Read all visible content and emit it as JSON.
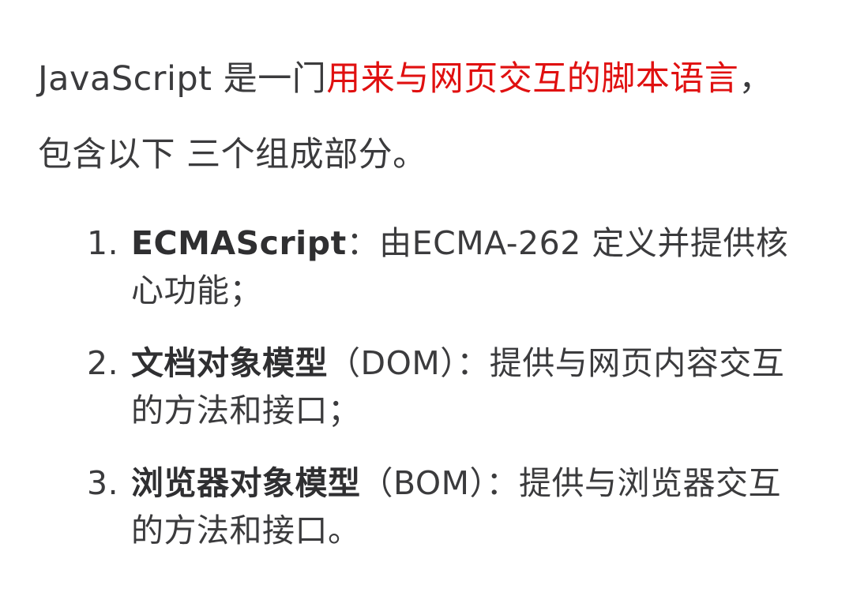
{
  "intro": {
    "prefix": "JavaScript 是一门",
    "highlight": "用来与网页交互的脚本语言",
    "suffix": "，包含以下 三个组成部分。",
    "highlight_color": "#e01010"
  },
  "items": [
    {
      "number": "1.",
      "term": "ECMAScript",
      "description": "：由ECMA-262 定义并提供核心功能；"
    },
    {
      "number": "2.",
      "term": "文档对象模型",
      "description": "（DOM）：提供与网页内容交互的方法和接口；"
    },
    {
      "number": "3.",
      "term": "浏览器对象模型",
      "description": "（BOM）：提供与浏览器交互的方法和接口。"
    }
  ]
}
